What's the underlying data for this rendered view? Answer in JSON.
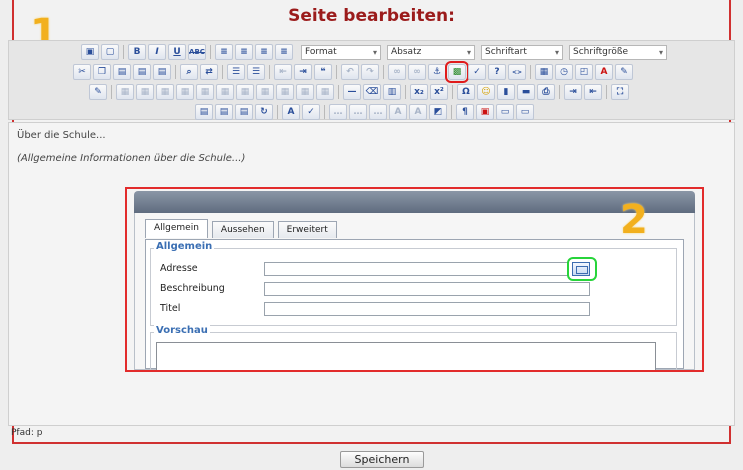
{
  "page": {
    "title": "Seite bearbeiten:"
  },
  "steps": {
    "one": "1",
    "two": "2"
  },
  "toolbar": {
    "format": "Format",
    "absatz": "Absatz",
    "schriftart": "Schriftart",
    "schriftgroesse": "Schriftgröße",
    "row1_icons": [
      "save-icon",
      "new-page-icon",
      "bold-icon",
      "italic-icon",
      "underline-icon",
      "strikethrough-icon",
      "align-left-icon",
      "align-center-icon",
      "align-right-icon",
      "align-justify-icon"
    ],
    "bold_glyph": "B",
    "italic_glyph": "I",
    "underline_glyph": "U",
    "strike_glyph": "ABC"
  },
  "editor": {
    "para1": "Über die Schule...",
    "para2": "(Allgemeine Informationen über die Schule...)"
  },
  "dialog": {
    "tabs": [
      "Allgemein",
      "Aussehen",
      "Erweitert"
    ],
    "section_general": "Allgemein",
    "label_address": "Adresse",
    "label_description": "Beschreibung",
    "label_title": "Titel",
    "section_preview": "Vorschau",
    "address_value": "",
    "description_value": "",
    "title_value": ""
  },
  "status": {
    "path": "Pfad: p"
  },
  "footer": {
    "save": "Speichern"
  },
  "colors": {
    "accent_red": "#e01b1b",
    "highlight_green": "#27d43a",
    "step_orange": "#f2b01e",
    "title_red": "#9b1b1b"
  }
}
